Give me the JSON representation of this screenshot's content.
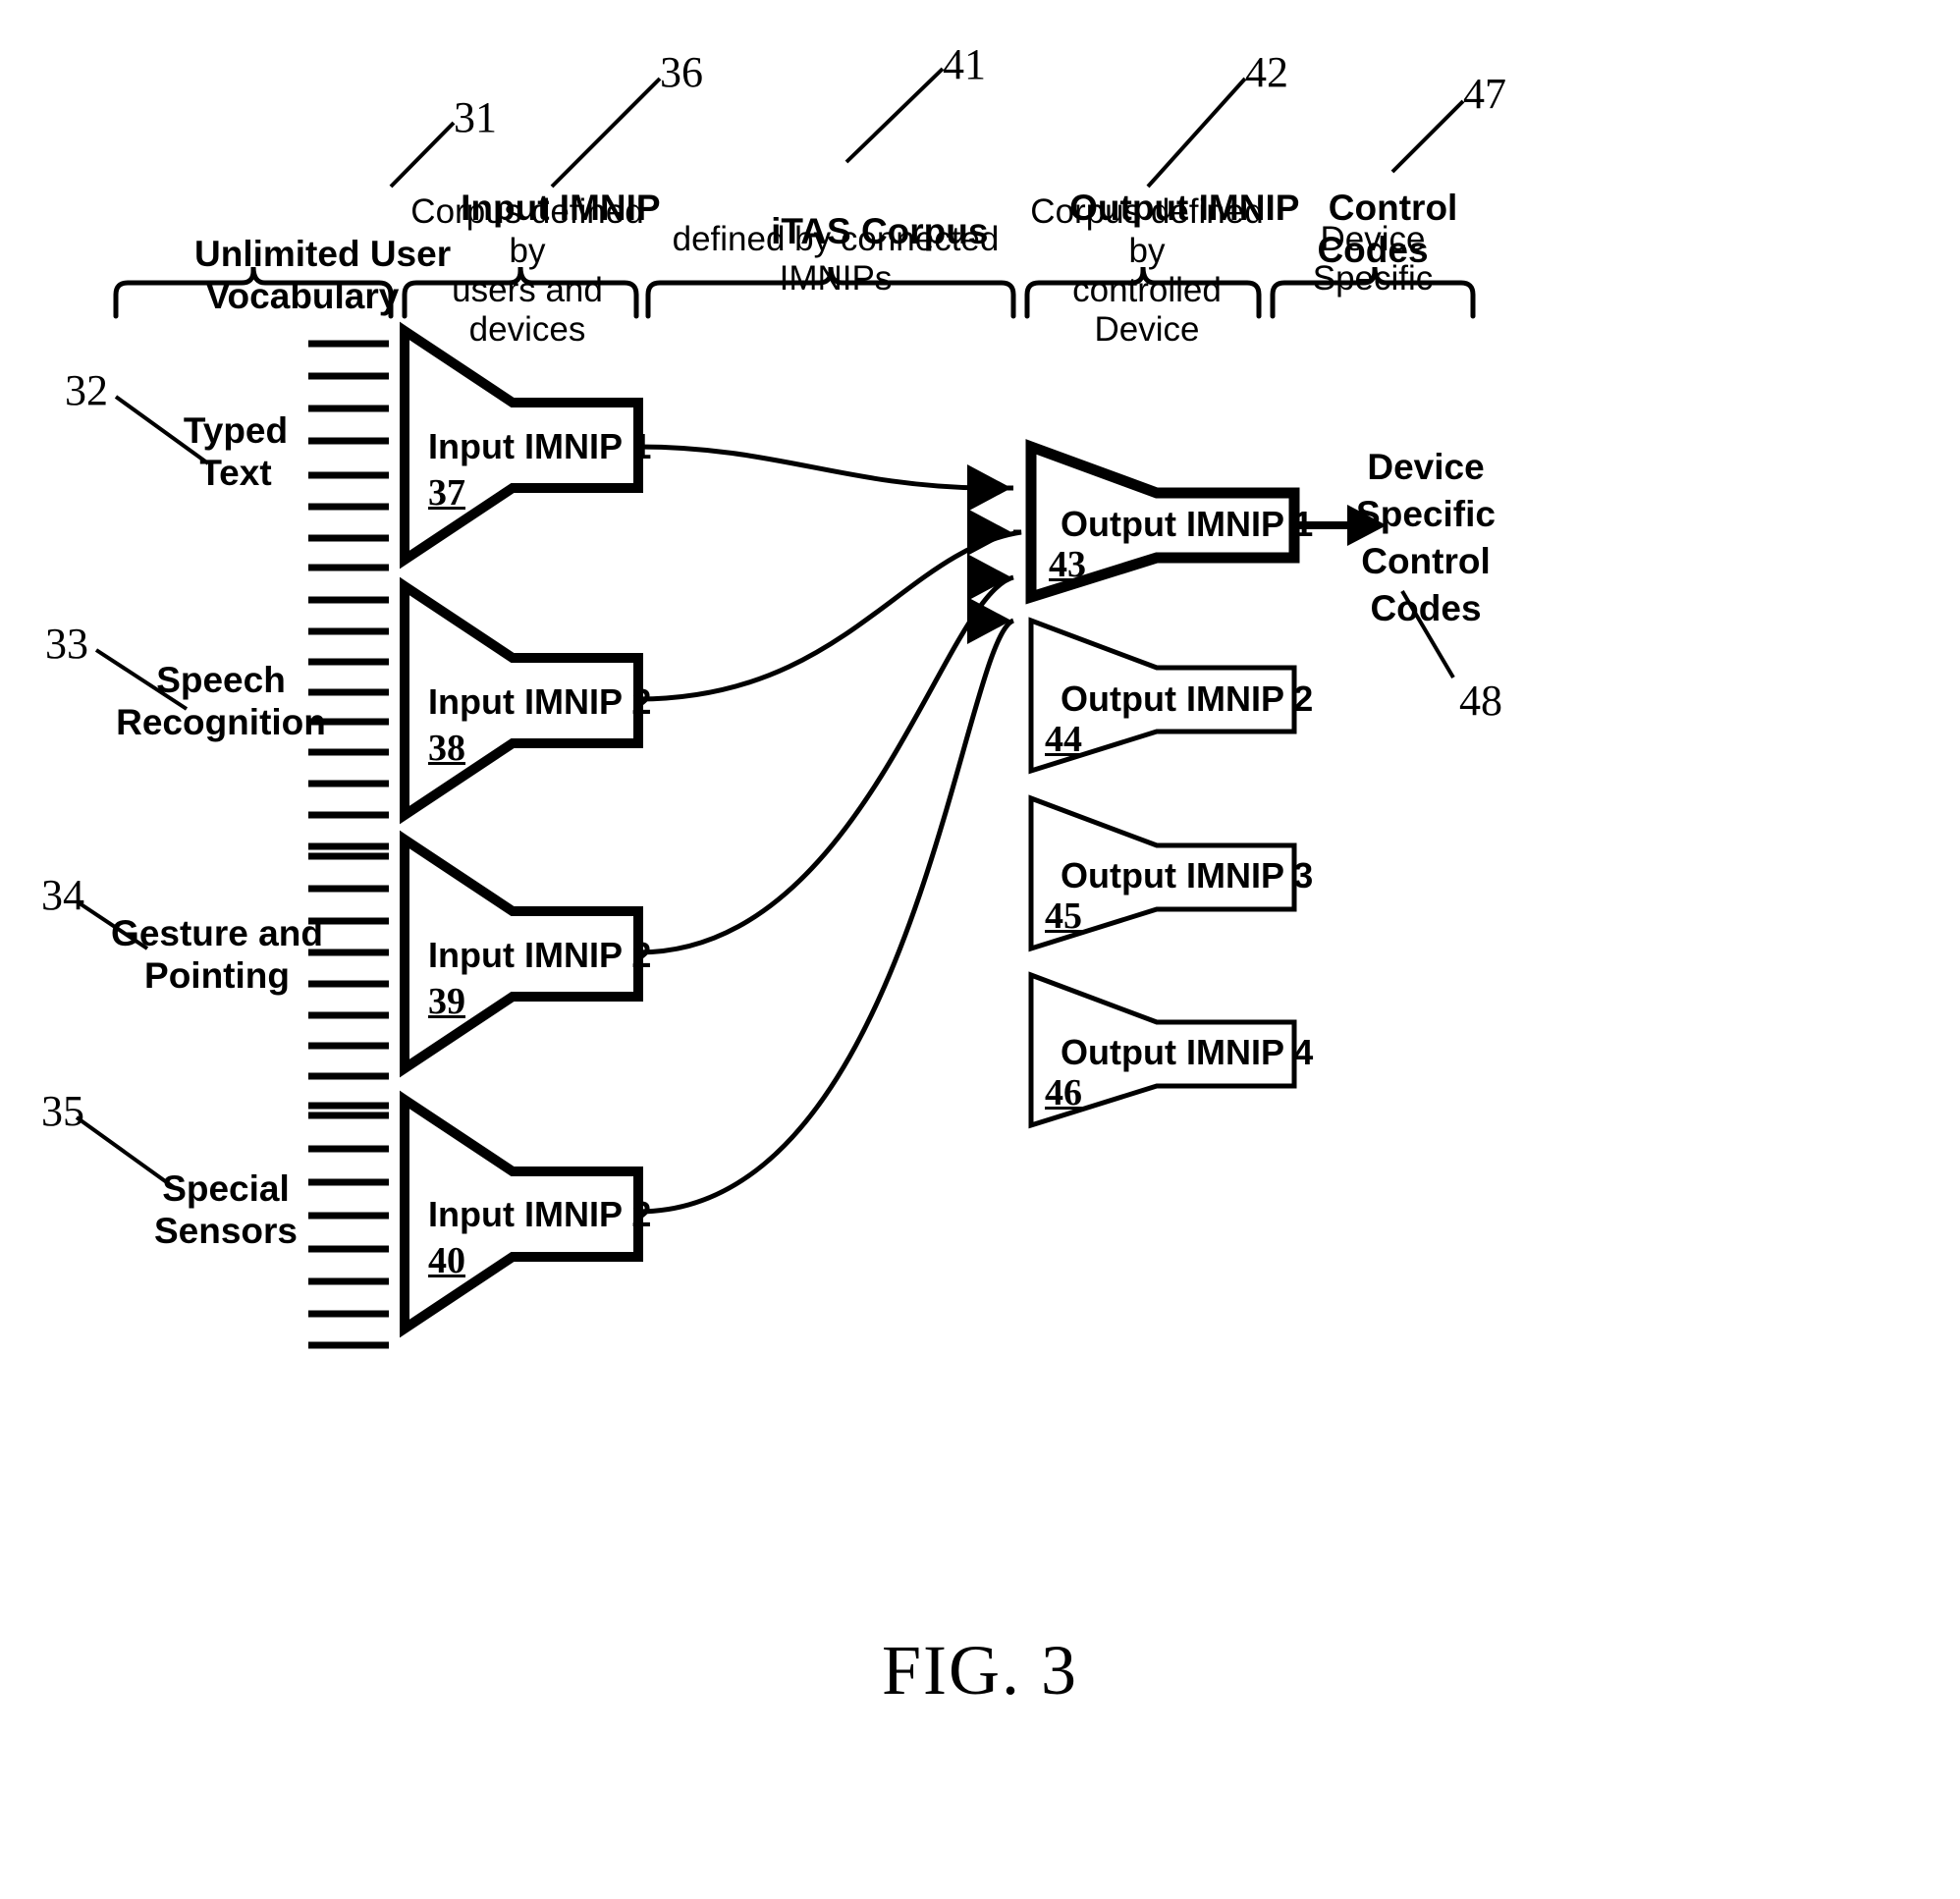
{
  "figure": {
    "caption": "FIG. 3",
    "title_columns": [
      {
        "ref": "31",
        "title": "Unlimited User\nVocabulary",
        "subtitle": ""
      },
      {
        "ref": "36",
        "title": "Input IMNIP",
        "subtitle": "Corpus defined by\nusers and devices"
      },
      {
        "ref": "41",
        "title": "iTAS Corpus",
        "subtitle": "defined by connected IMNIPs"
      },
      {
        "ref": "42",
        "title": "Output IMNIP",
        "subtitle": "Corpus defined by\ncontrolled Device"
      },
      {
        "ref": "47",
        "title": "Control\nCodes",
        "subtitle": "Device Specific"
      }
    ],
    "input_modalities": [
      {
        "ref": "32",
        "label": "Typed\nText"
      },
      {
        "ref": "33",
        "label": "Speech\nRecognition"
      },
      {
        "ref": "34",
        "label": "Gesture and\nPointing"
      },
      {
        "ref": "35",
        "label": "Special\nSensors"
      }
    ],
    "input_blocks": [
      {
        "label": "Input IMNIP 1",
        "num": "37",
        "emphasis": "thick"
      },
      {
        "label": "Input IMNIP 2",
        "num": "38",
        "emphasis": "thick"
      },
      {
        "label": "Input IMNIP 2",
        "num": "39",
        "emphasis": "thick"
      },
      {
        "label": "Input IMNIP 2",
        "num": "40",
        "emphasis": "thick"
      }
    ],
    "output_blocks": [
      {
        "label": "Output IMNIP 1",
        "num": "43",
        "emphasis": "thick"
      },
      {
        "label": "Output IMNIP 2",
        "num": "44",
        "emphasis": "thin"
      },
      {
        "label": "Output IMNIP 3",
        "num": "45",
        "emphasis": "thin"
      },
      {
        "label": "Output IMNIP 4",
        "num": "46",
        "emphasis": "thin"
      }
    ],
    "control_output": {
      "label": "Device\nSpecific\nControl\nCodes",
      "ref": "48"
    },
    "vocabulary_tick_counts": [
      8,
      9,
      9,
      8
    ],
    "connection_count": 4,
    "colors": {
      "stroke": "#000000",
      "background": "#ffffff"
    }
  }
}
